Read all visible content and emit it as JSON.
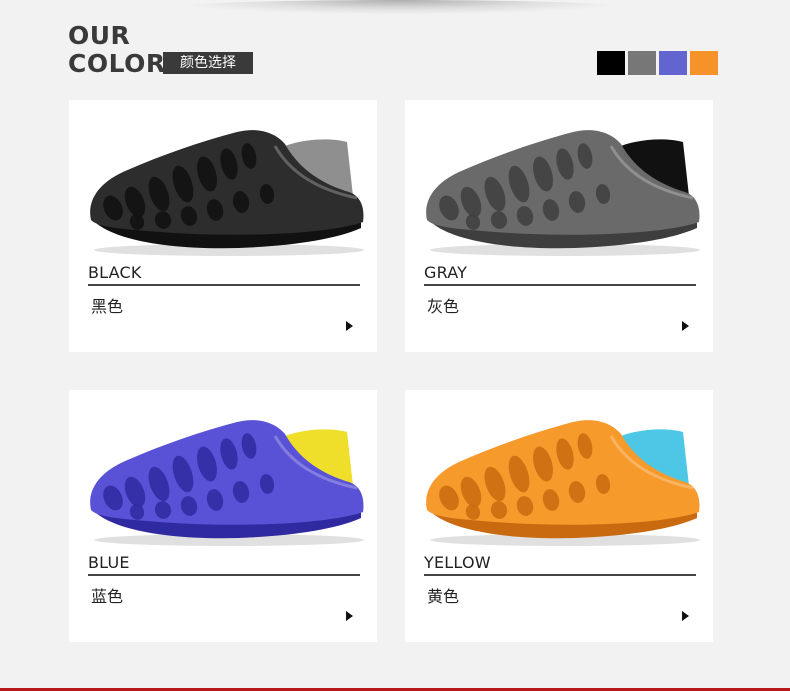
{
  "header": {
    "title_line1": "OUR",
    "title_line2": "COLOR",
    "badge": "颜色选择"
  },
  "swatches": [
    "#000000",
    "#777777",
    "#6265d0",
    "#f5922a"
  ],
  "cards": [
    {
      "en": "BLACK",
      "cn": "黑色",
      "shoe": "#2d2d2d",
      "shoe_dark": "#111111",
      "lining": "#8f8f8f"
    },
    {
      "en": "GRAY",
      "cn": "灰色",
      "shoe": "#6a6a6a",
      "shoe_dark": "#3e3e3e",
      "lining": "#111111"
    },
    {
      "en": "BLUE",
      "cn": "蓝色",
      "shoe": "#5a52d6",
      "shoe_dark": "#302aa0",
      "lining": "#f0df2a"
    },
    {
      "en": "YELLOW",
      "cn": "黄色",
      "shoe": "#f79a2c",
      "shoe_dark": "#c96a10",
      "lining": "#4ec7e6"
    }
  ]
}
